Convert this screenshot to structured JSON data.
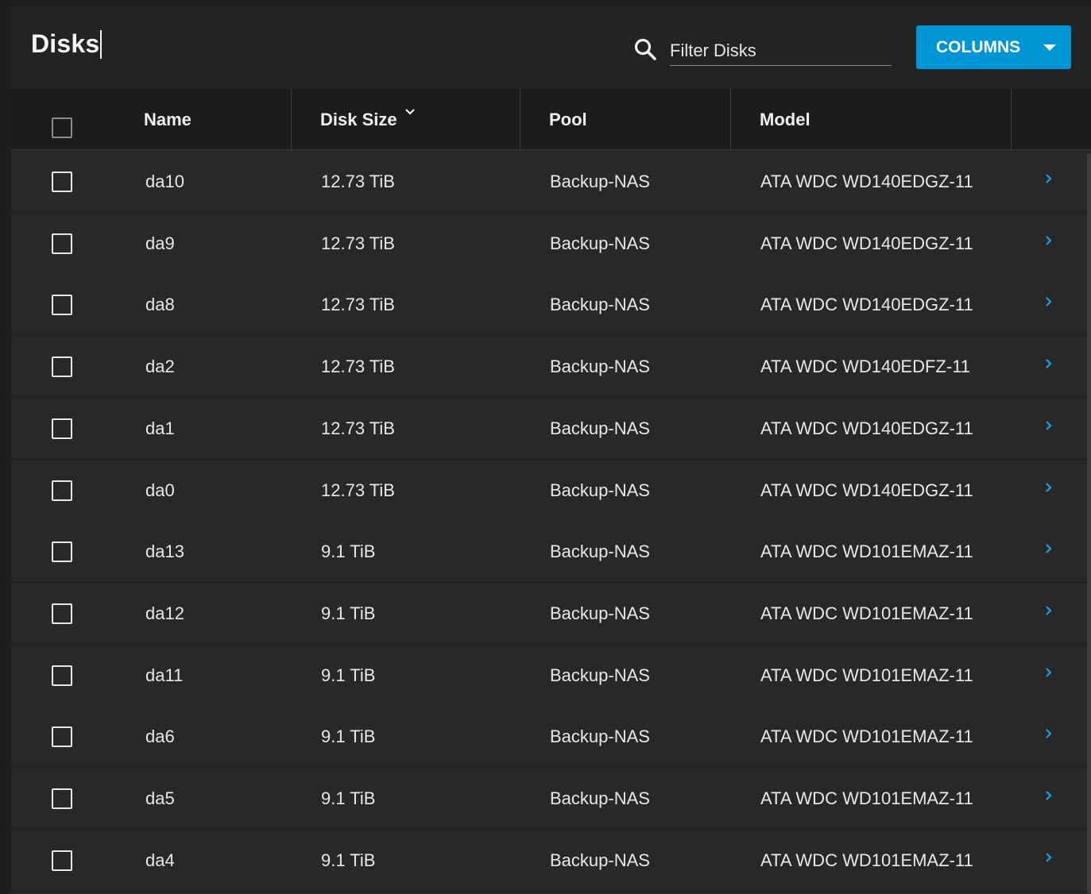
{
  "title": "Disks",
  "search": {
    "placeholder": "Filter Disks",
    "value": ""
  },
  "columns_button": {
    "label": "COLUMNS"
  },
  "headers": {
    "name": "Name",
    "disk_size": "Disk Size",
    "pool": "Pool",
    "model": "Model"
  },
  "colors": {
    "accent": "#0095d5",
    "background": "#282828",
    "header": "#1c1c1c"
  },
  "rows": [
    {
      "name": "da10",
      "size": "12.73 TiB",
      "pool": "Backup-NAS",
      "model": "ATA WDC WD140EDGZ-11"
    },
    {
      "name": "da9",
      "size": "12.73 TiB",
      "pool": "Backup-NAS",
      "model": "ATA WDC WD140EDGZ-11"
    },
    {
      "name": "da8",
      "size": "12.73 TiB",
      "pool": "Backup-NAS",
      "model": "ATA WDC WD140EDGZ-11"
    },
    {
      "name": "da2",
      "size": "12.73 TiB",
      "pool": "Backup-NAS",
      "model": "ATA WDC WD140EDFZ-11"
    },
    {
      "name": "da1",
      "size": "12.73 TiB",
      "pool": "Backup-NAS",
      "model": "ATA WDC WD140EDGZ-11"
    },
    {
      "name": "da0",
      "size": "12.73 TiB",
      "pool": "Backup-NAS",
      "model": "ATA WDC WD140EDGZ-11"
    },
    {
      "name": "da13",
      "size": "9.1 TiB",
      "pool": "Backup-NAS",
      "model": "ATA WDC WD101EMAZ-11"
    },
    {
      "name": "da12",
      "size": "9.1 TiB",
      "pool": "Backup-NAS",
      "model": "ATA WDC WD101EMAZ-11"
    },
    {
      "name": "da11",
      "size": "9.1 TiB",
      "pool": "Backup-NAS",
      "model": "ATA WDC WD101EMAZ-11"
    },
    {
      "name": "da6",
      "size": "9.1 TiB",
      "pool": "Backup-NAS",
      "model": "ATA WDC WD101EMAZ-11"
    },
    {
      "name": "da5",
      "size": "9.1 TiB",
      "pool": "Backup-NAS",
      "model": "ATA WDC WD101EMAZ-11"
    },
    {
      "name": "da4",
      "size": "9.1 TiB",
      "pool": "Backup-NAS",
      "model": "ATA WDC WD101EMAZ-11"
    }
  ]
}
